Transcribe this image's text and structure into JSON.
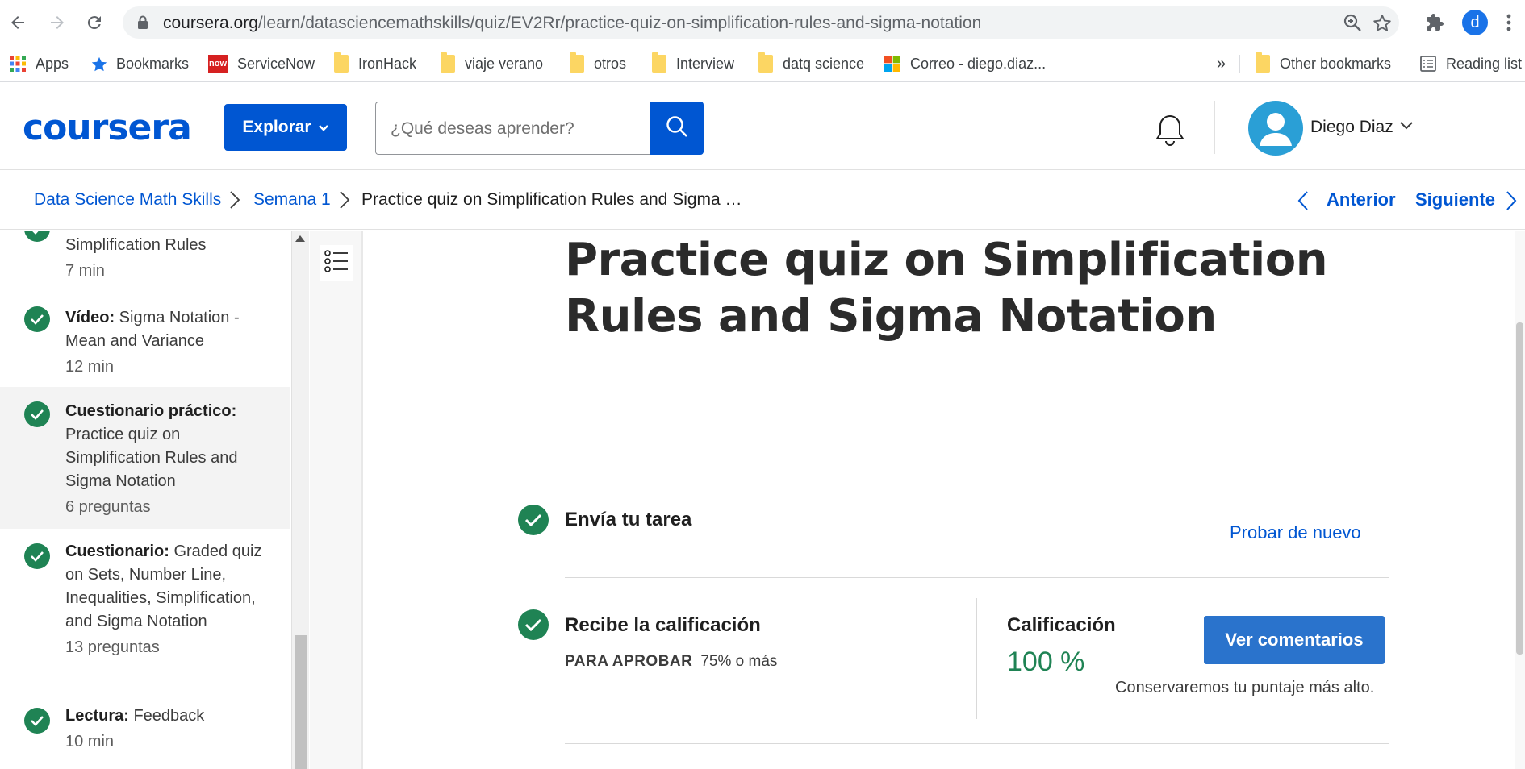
{
  "browser": {
    "url_host": "coursera.org",
    "url_path": "/learn/datasciencemathskills/quiz/EV2Rr/practice-quiz-on-simplification-rules-and-sigma-notation",
    "profile_initial": "d"
  },
  "bookmarks": [
    {
      "label": "Apps",
      "icon": "apps-grid-icon"
    },
    {
      "label": "Bookmarks",
      "icon": "star-icon"
    },
    {
      "label": "ServiceNow",
      "icon": "servicenow-icon"
    },
    {
      "label": "IronHack",
      "icon": "folder-icon"
    },
    {
      "label": "viaje verano",
      "icon": "folder-icon"
    },
    {
      "label": "otros",
      "icon": "folder-icon"
    },
    {
      "label": "Interview",
      "icon": "folder-icon"
    },
    {
      "label": "datq science",
      "icon": "folder-icon"
    },
    {
      "label": "Correo - diego.diaz...",
      "icon": "microsoft-icon"
    }
  ],
  "bookmarks_overflow": "»",
  "other_bookmarks": "Other bookmarks",
  "reading_list": "Reading list",
  "servicenow_badge": "now",
  "header": {
    "logo": "coursera",
    "explore_label": "Explorar",
    "search_placeholder": "¿Qué deseas aprender?",
    "user_name": "Diego Diaz"
  },
  "breadcrumb": {
    "course": "Data Science Math Skills",
    "week": "Semana 1",
    "current": "Practice quiz on Simplification Rules and Sigma …",
    "prev": "Anterior",
    "next": "Siguiente"
  },
  "sidebar": {
    "items": [
      {
        "type": "",
        "title": "Simplification Rules",
        "meta": "7 min"
      },
      {
        "type": "Vídeo:",
        "title": "Sigma Notation - Mean and Variance",
        "meta": "12 min"
      },
      {
        "type": "Cuestionario práctico:",
        "title": "Practice quiz on Simplification Rules and Sigma Notation",
        "meta": "6 preguntas"
      },
      {
        "type": "Cuestionario:",
        "title": "Graded quiz on Sets, Number Line, Inequalities, Simplification, and Sigma Notation",
        "meta": "13 preguntas"
      },
      {
        "type": "Lectura:",
        "title": "Feedback",
        "meta": "10 min"
      }
    ]
  },
  "main": {
    "title": "Practice quiz on Simplification Rules and Sigma Notation",
    "submit_step": "Envía tu tarea",
    "retry": "Probar de nuevo",
    "grade_step": "Recibe la calificación",
    "pass_label": "PARA APROBAR",
    "pass_value": "75% o más",
    "grade_label": "Calificación",
    "grade_value": "100 %",
    "feedback_button": "Ver comentarios",
    "keep_note": "Conservaremos tu puntaje más alto."
  },
  "colors": {
    "brand_blue": "#0056d2",
    "success_green": "#1f8354",
    "button_blue": "#2a73cc"
  }
}
